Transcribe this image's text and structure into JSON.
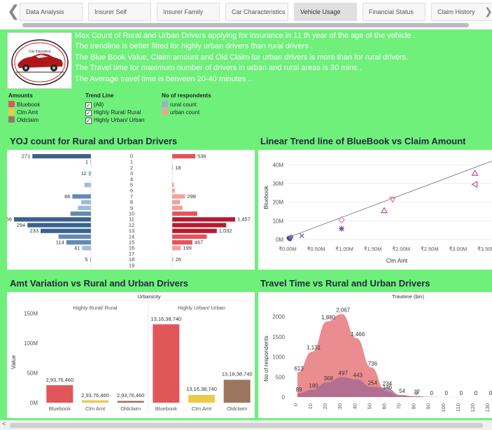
{
  "tabs": [
    {
      "label": "Data Analysis",
      "active": false
    },
    {
      "label": "Insurer Self",
      "active": false
    },
    {
      "label": "Insurer Family",
      "active": false
    },
    {
      "label": "Car Characteristics",
      "active": false
    },
    {
      "label": "Vehicle Usage",
      "active": true
    },
    {
      "label": "Financial Status",
      "active": false
    },
    {
      "label": "Claim History",
      "active": false
    }
  ],
  "nav": {
    "prev": "❮",
    "next": "❯"
  },
  "logo_text": "Car Insurance",
  "story_lines": [
    "Max Count of Rural and Urban Drivers applying for insurance in 11 th year of the age of the vehicle .",
    "The trendline is better fitted for highly urban drivers than rural drivers .",
    "The Blue Book Value, Claim amount and Old Claim for urban drivers is more than for rural drivers.",
    "The Travel time for maximum number of drivers in urban and rural areas is 30 mins .",
    "The Average travel time is between 20-40 minutes .."
  ],
  "legend": {
    "amounts": {
      "title": "Amounts",
      "items": [
        {
          "label": "Bluebook",
          "color": "#e15759"
        },
        {
          "label": "Clm Amt",
          "color": "#edc948"
        },
        {
          "label": "Oldclaim",
          "color": "#9c755f"
        }
      ]
    },
    "trend": {
      "title": "Trend Line",
      "items": [
        {
          "label": "(All)"
        },
        {
          "label": "Highly Rural/ Rural"
        },
        {
          "label": "Highly Urban/ Urban"
        }
      ]
    },
    "respondents": {
      "title": "No of respondents",
      "items": [
        {
          "label": "rural count",
          "color": "#9ab0cc"
        },
        {
          "label": "urban count",
          "color": "#f4a09a"
        }
      ]
    }
  },
  "panels": {
    "yoj": {
      "title": "YOJ count for Rural and Urban Drivers"
    },
    "trend": {
      "title": "Linear Trend line of BlueBook vs Claim Amount"
    },
    "amt": {
      "title": "Amt Variation vs Rural and  Urban Drivers"
    },
    "travel": {
      "title": "Travel Time vs Rural and Urban Drivers"
    }
  },
  "chart_data": [
    {
      "type": "bar",
      "title": "YOJ count for Rural and Urban Drivers",
      "categories": [
        "0",
        "1",
        "2",
        "3",
        "4",
        "5",
        "6",
        "7",
        "8",
        "9",
        "10",
        "11",
        "12",
        "13",
        "14",
        "15",
        "16",
        "17",
        "18",
        "19"
      ],
      "series": [
        {
          "name": "rural count",
          "values": [
            271,
            1,
            null,
            11,
            null,
            30,
            null,
            86,
            45,
            60,
            95,
            356,
            294,
            233,
            150,
            114,
            41,
            null,
            5,
            null
          ],
          "labels": {
            "0": "271",
            "1": "1",
            "3": "11",
            "7": "86",
            "11": "356",
            "12": "294",
            "13": "233",
            "15": "114",
            "16": "41",
            "18": "5"
          }
        },
        {
          "name": "urban count",
          "values": [
            536,
            null,
            18,
            null,
            null,
            40,
            60,
            298,
            180,
            240,
            580,
            1457,
            1250,
            1032,
            800,
            467,
            199,
            null,
            26,
            null
          ],
          "labels": {
            "0": "536",
            "2": "18",
            "7": "298",
            "11": "1,457",
            "13": "1,032",
            "15": "467",
            "16": "199",
            "18": "26"
          }
        }
      ],
      "xrange": {
        "rural": [
          0,
          356
        ],
        "urban": [
          0,
          1457
        ]
      }
    },
    {
      "type": "scatter",
      "title": "Linear Trend line of BlueBook vs Claim Amount",
      "xlabel": "Clm Amt",
      "ylabel": "Bluebook",
      "xticks": [
        "₹0.00M",
        "₹0.50M",
        "₹1.00M",
        "₹1.50M",
        "₹2.00M",
        "₹2.50M",
        "₹3.00M",
        "₹3.50M"
      ],
      "yticks": [
        "0M",
        "10M",
        "20M",
        "30M",
        "40M"
      ],
      "xlim": [
        0,
        3.6
      ],
      "ylim": [
        0,
        45
      ],
      "points": [
        {
          "x": 0.02,
          "y": 0.8,
          "shape": "circle",
          "color": "#59468a"
        },
        {
          "x": 0.04,
          "y": 0.3,
          "shape": "circle",
          "color": "#59468a"
        },
        {
          "x": 0.06,
          "y": 1.3,
          "shape": "circle",
          "color": "#7a6aa8"
        },
        {
          "x": 0.25,
          "y": 2.0,
          "shape": "x",
          "color": "#6a5fa5"
        },
        {
          "x": 0.95,
          "y": 5.8,
          "shape": "star",
          "color": "#7b4a9e"
        },
        {
          "x": 0.95,
          "y": 10.5,
          "shape": "diamond",
          "color": "#e08bd0"
        },
        {
          "x": 1.7,
          "y": 15.5,
          "shape": "triangle",
          "color": "#c35ca8"
        },
        {
          "x": 1.85,
          "y": 21.5,
          "shape": "triangle-down",
          "color": "#e07aa8"
        },
        {
          "x": 3.3,
          "y": 35.5,
          "shape": "triangle",
          "color": "#c35ca8"
        },
        {
          "x": 3.3,
          "y": 29.5,
          "shape": "triangle-left",
          "color": "#c35ca8"
        }
      ],
      "trendline": {
        "from": [
          0,
          1
        ],
        "to": [
          3.6,
          42
        ]
      }
    },
    {
      "type": "bar",
      "title": "Amt Variation vs Rural and  Urban Drivers",
      "header": "Urbanicity",
      "groups": [
        "Highly Rural/ Rural",
        "Highly Urban/ Urban"
      ],
      "categories": [
        "Bluebook",
        "Clm Amt",
        "Oldclaim"
      ],
      "series": [
        {
          "name": "Highly Rural/ Rural",
          "values": [
            29376460,
            4000000,
            3000000
          ],
          "labels": [
            "2,93,76,460",
            "2,93,76,460",
            "2,93,76,460"
          ]
        },
        {
          "name": "Highly Urban/ Urban",
          "values": [
            131638740,
            13000000,
            38500000
          ],
          "labels": [
            "13,16,38,740",
            "13,16,38,740",
            "13,16,38,740"
          ]
        }
      ],
      "colors": [
        "#e15759",
        "#edc948",
        "#9c755f"
      ],
      "ylabel": "Value",
      "yticks": [
        "0M",
        "50M",
        "100M",
        "150M"
      ],
      "ylim": [
        0,
        160000000
      ]
    },
    {
      "type": "area",
      "title": "Travel Time vs Rural and Urban Drivers",
      "header": "Travtime (bin)",
      "xlabel": "",
      "ylabel": "No of respondents",
      "x": [
        0,
        10,
        20,
        30,
        40,
        50,
        60,
        70,
        80,
        90,
        100,
        110,
        120,
        130
      ],
      "series": [
        {
          "name": "urban count",
          "values": [
            613,
            1131,
            1880,
            2067,
            1466,
            736,
            146,
            20,
            27,
            5,
            2,
            1,
            1,
            1
          ]
        },
        {
          "name": "rural count",
          "values": [
            89,
            180,
            368,
            497,
            443,
            254,
            234,
            54,
            9,
            3,
            1,
            1,
            1,
            1
          ]
        }
      ],
      "labels": [
        {
          "text": "613",
          "x": 0,
          "y": 613
        },
        {
          "text": "1,131",
          "x": 10,
          "y": 1131
        },
        {
          "text": "1,880",
          "x": 20,
          "y": 1880
        },
        {
          "text": "2,067",
          "x": 30,
          "y": 2067
        },
        {
          "text": "1,466",
          "x": 40,
          "y": 1466
        },
        {
          "text": "736",
          "x": 50,
          "y": 736
        },
        {
          "text": "146",
          "x": 60,
          "y": 146
        },
        {
          "text": "27",
          "x": 80,
          "y": 27
        },
        {
          "text": "89",
          "x": 0,
          "y": 89
        },
        {
          "text": "180",
          "x": 10,
          "y": 180
        },
        {
          "text": "368",
          "x": 20,
          "y": 368
        },
        {
          "text": "497",
          "x": 30,
          "y": 497
        },
        {
          "text": "443",
          "x": 40,
          "y": 443
        },
        {
          "text": "254",
          "x": 50,
          "y": 254
        },
        {
          "text": "234",
          "x": 60,
          "y": 234
        },
        {
          "text": "54",
          "x": 70,
          "y": 54
        },
        {
          "text": "9",
          "x": 80,
          "y": 9
        },
        {
          "text": "0",
          "x": 90,
          "y": 0
        },
        {
          "text": "0",
          "x": 100,
          "y": 0
        },
        {
          "text": "0",
          "x": 110,
          "y": 0
        },
        {
          "text": "0",
          "x": 120,
          "y": 0
        },
        {
          "text": "0",
          "x": 130,
          "y": 0
        }
      ],
      "yticks": [
        "0",
        "500",
        "1000",
        "1500",
        "2000"
      ],
      "ylim": [
        0,
        2300
      ],
      "colors": {
        "urban": "#e8787c",
        "rural": "#a0668f"
      }
    }
  ]
}
